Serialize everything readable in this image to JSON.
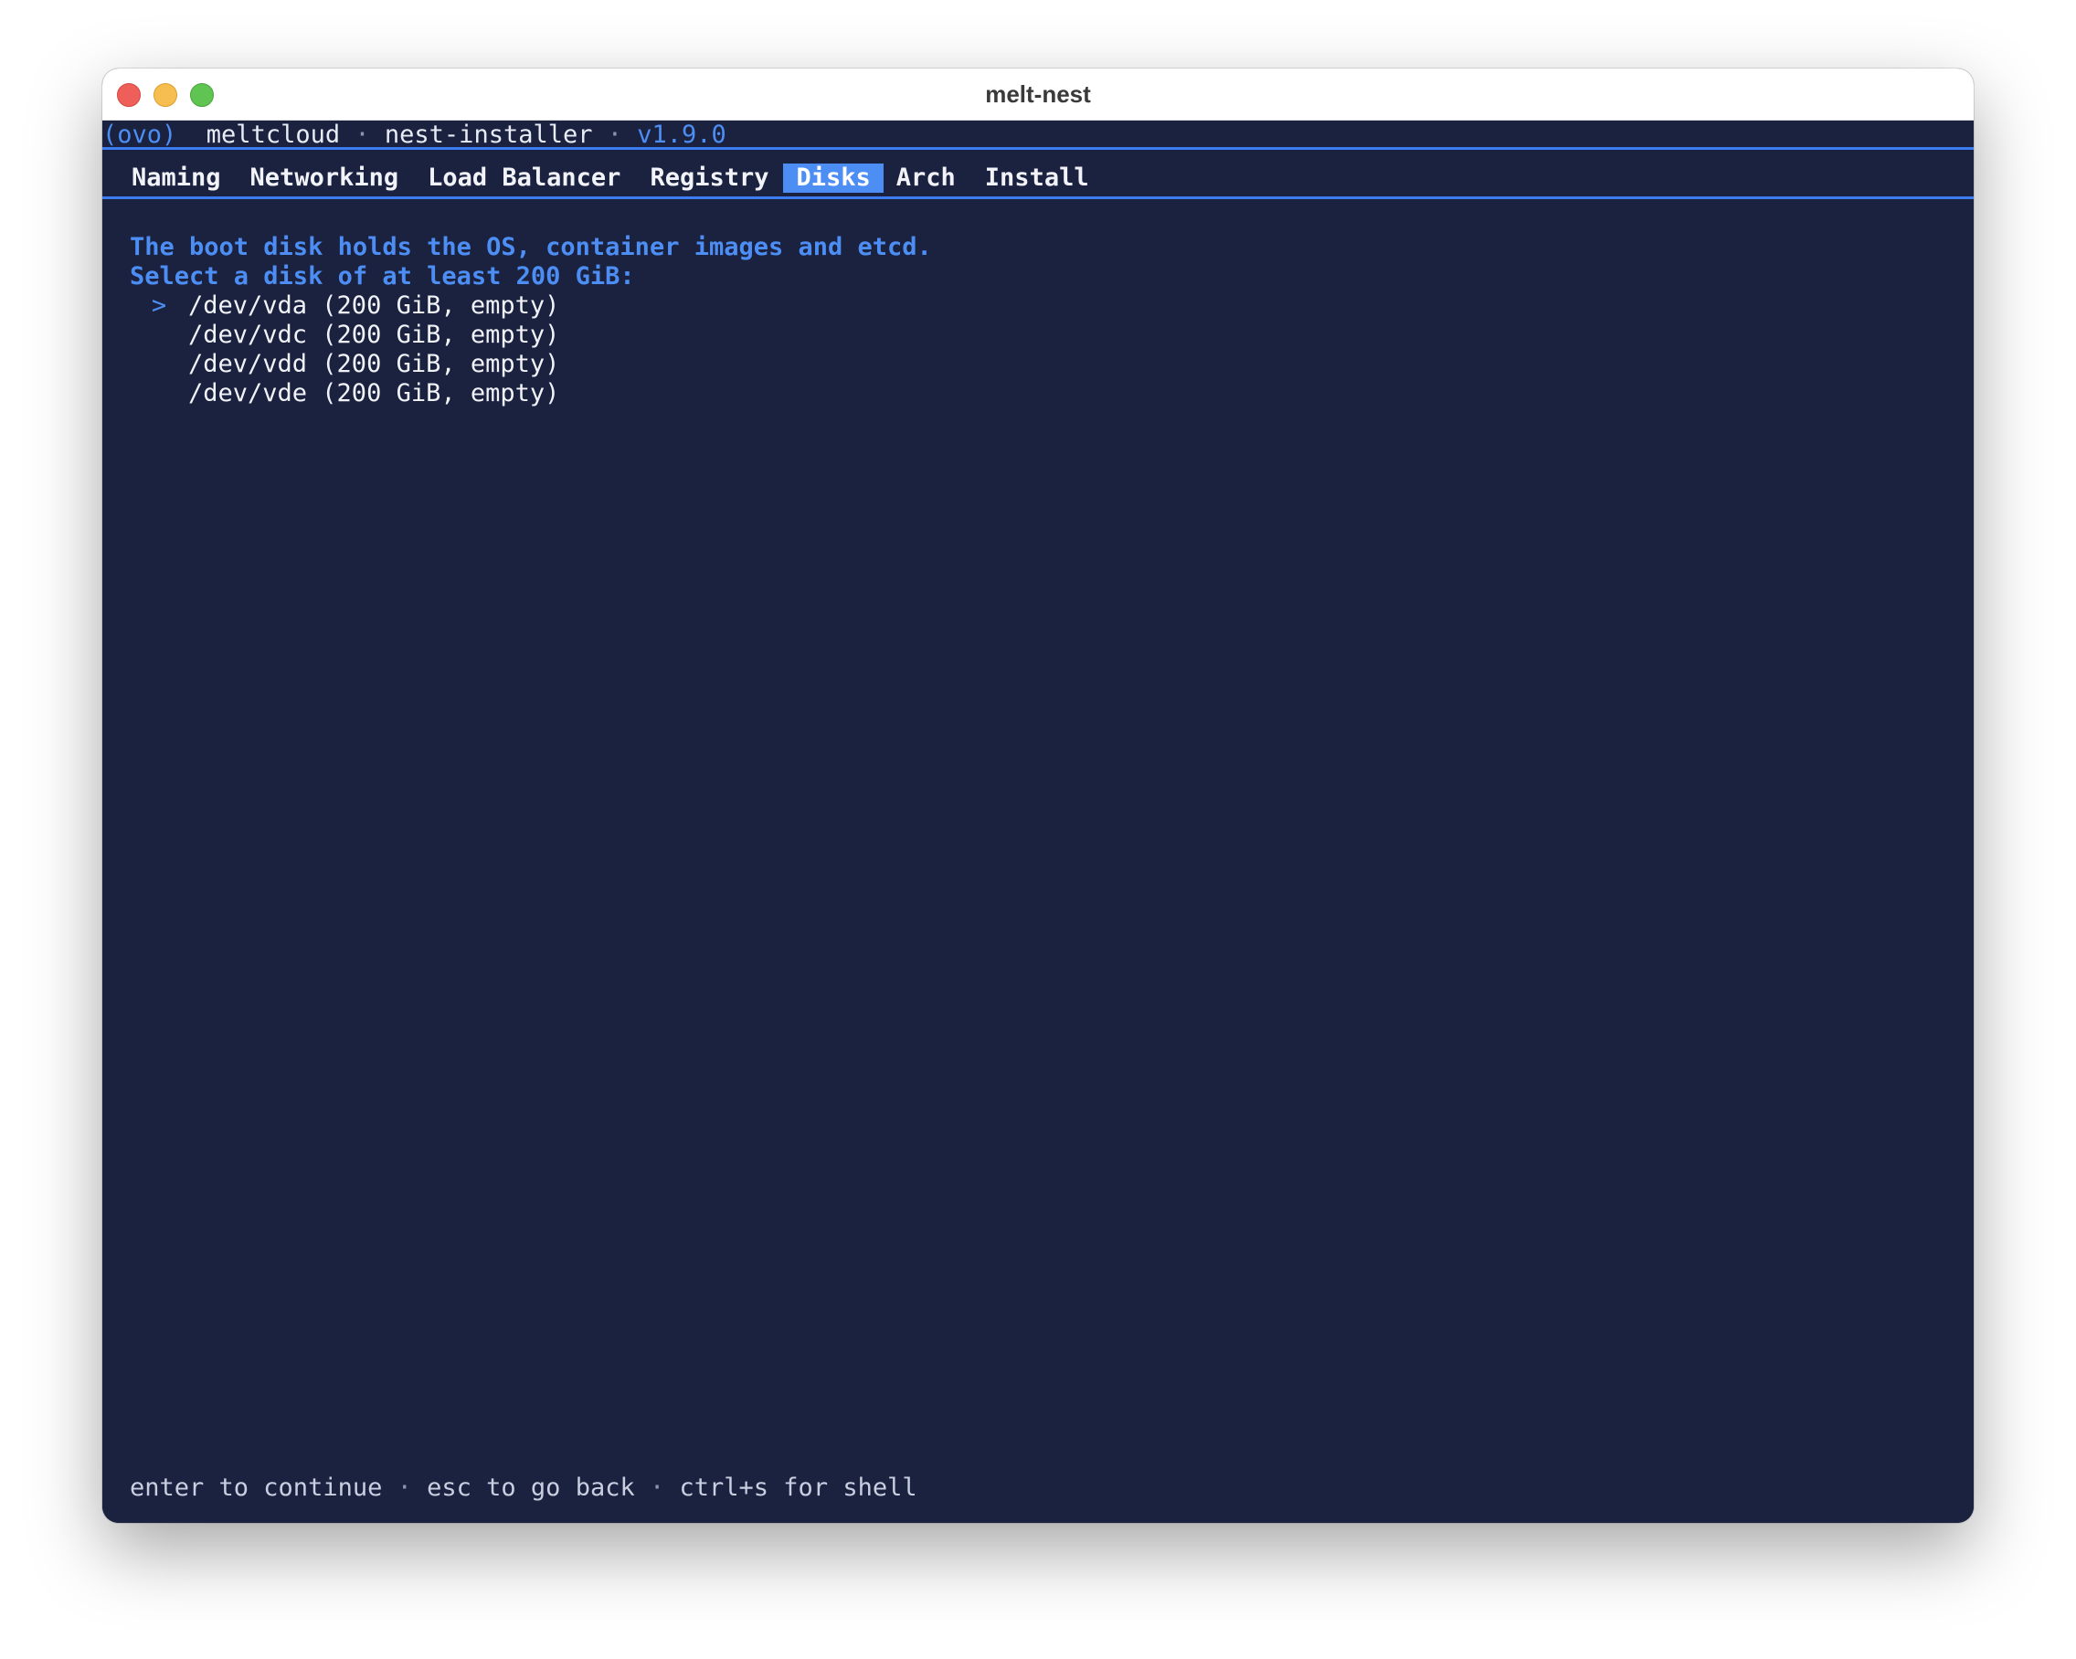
{
  "window": {
    "title": "melt-nest"
  },
  "header": {
    "logo": "(ovo)",
    "brand": "meltcloud",
    "separator": "·",
    "app": "nest-installer",
    "version": "v1.9.0"
  },
  "tabs": [
    {
      "label": "Naming",
      "active": false
    },
    {
      "label": "Networking",
      "active": false
    },
    {
      "label": "Load Balancer",
      "active": false
    },
    {
      "label": "Registry",
      "active": false
    },
    {
      "label": "Disks",
      "active": true
    },
    {
      "label": "Arch",
      "active": false
    },
    {
      "label": "Install",
      "active": false
    }
  ],
  "main": {
    "description": "The boot disk holds the OS, container images and etcd.",
    "prompt": "Select a disk of at least 200 GiB:",
    "cursor_symbol": ">",
    "disks": [
      {
        "label": "/dev/vda (200 GiB, empty)",
        "selected": true
      },
      {
        "label": "/dev/vdc (200 GiB, empty)",
        "selected": false
      },
      {
        "label": "/dev/vdd (200 GiB, empty)",
        "selected": false
      },
      {
        "label": "/dev/vde (200 GiB, empty)",
        "selected": false
      }
    ]
  },
  "footer": {
    "hint_continue": "enter to continue",
    "hint_back": "esc to go back",
    "hint_shell": "ctrl+s for shell",
    "separator": "·"
  },
  "colors": {
    "background": "#1b2240",
    "accent": "#4d8ef5",
    "text": "#f1f3f8"
  }
}
